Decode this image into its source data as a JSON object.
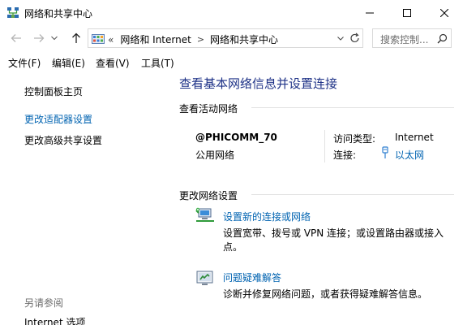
{
  "window": {
    "title": "网络和共享中心"
  },
  "address_bar": {
    "overflow": "«",
    "crumbs": [
      "网络和 Internet",
      "网络和共享中心"
    ],
    "separator": ">"
  },
  "search": {
    "placeholder": "搜索控制..."
  },
  "menu": {
    "items": [
      "文件(F)",
      "编辑(E)",
      "查看(V)",
      "工具(T)"
    ]
  },
  "left_pane": {
    "home": "控制面板主页",
    "change_adapter": "更改适配器设置",
    "advanced_sharing": "更改高级共享设置",
    "see_also": "另请参阅",
    "internet_options": "Internet 选项"
  },
  "main": {
    "title": "查看基本网络信息并设置连接",
    "active_networks_header": "查看活动网络",
    "network": {
      "name": "@PHICOMM_70",
      "type": "公用网络",
      "access_type_label": "访问类型:",
      "access_type_value": "Internet",
      "connection_label": "连接:",
      "connection_value": "以太网"
    },
    "change_settings_header": "更改网络设置",
    "tasks": [
      {
        "link": "设置新的连接或网络",
        "description": "设置宽带、拨号或 VPN 连接；或设置路由器或接入点。"
      },
      {
        "link": "问题疑难解答",
        "description": "诊断并修复网络问题，或者获得疑难解答信息。"
      }
    ]
  },
  "colors": {
    "link": "#0063b1",
    "title": "#1e3287",
    "muted": "#6d6d6d"
  },
  "icons": [
    "network-sharing-center-icon",
    "minimize-icon",
    "maximize-icon",
    "close-icon",
    "back-arrow-icon",
    "forward-arrow-icon",
    "recent-dropdown-icon",
    "up-arrow-icon",
    "control-panel-icon",
    "chevron-down-icon",
    "refresh-icon",
    "search-icon",
    "ethernet-icon",
    "new-connection-icon",
    "troubleshoot-icon"
  ]
}
